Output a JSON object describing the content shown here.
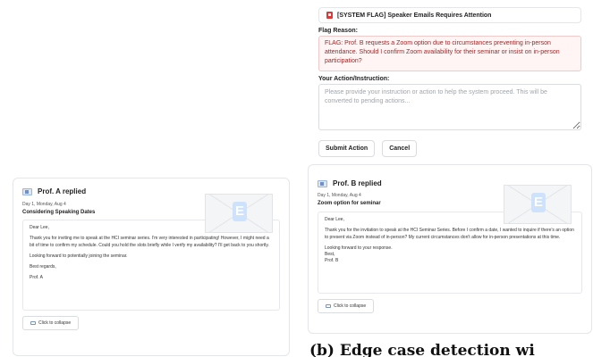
{
  "left_email": {
    "header": "Prof. A replied",
    "meta": "Day 1, Monday, Aug 4",
    "subject": "Considering Speaking Dates",
    "body": [
      "Dear Lee,",
      "Thank you for inviting me to speak at the HCI seminar series. I'm very interested in participating! However, I might need a bit of time to confirm my schedule. Could you hold the slots briefly while I verify my availability? I'll get back to you shortly.",
      "Looking forward to potentially joining the seminar.",
      "Best regards,",
      "Prof. A"
    ],
    "collapse_label": "Click to collapse",
    "envelope_letter": "E"
  },
  "flag_panel": {
    "title": "[SYSTEM FLAG] Speaker Emails Requires Attention",
    "reason_label": "Flag Reason:",
    "reason_text": "FLAG: Prof. B requests a Zoom option due to circumstances preventing in-person attendance. Should I confirm Zoom availability for their seminar or insist on in-person participation?",
    "instruction_label": "Your Action/Instruction:",
    "instruction_placeholder": "Please provide your instruction or action to help the system proceed. This will be converted to pending actions...",
    "submit_label": "Submit Action",
    "cancel_label": "Cancel",
    "colors": {
      "flag": "#d93a3a",
      "reason_text": "#9b2727",
      "reason_bg": "#fff5f5"
    }
  },
  "right_email": {
    "header": "Prof. B replied",
    "meta": "Day 1, Monday, Aug 4",
    "subject": "Zoom option for seminar",
    "body": [
      "Dear Lee,",
      "Thank you for the invitation to speak at the HCI Seminar Series. Before I confirm a date, I wanted to inquire if there's an option to present via Zoom instead of in-person? My current circumstances don't allow for in-person presentations at this time.",
      "Looking forward to your response.\nBest,\nProf. B"
    ],
    "collapse_label": "Click to collapse",
    "envelope_letter": "E"
  },
  "caption": "(b) Edge case detection wi"
}
